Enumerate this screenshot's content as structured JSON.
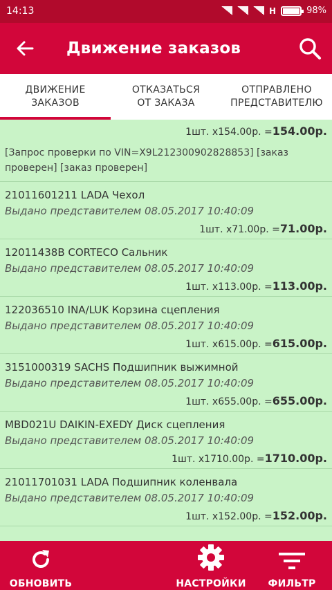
{
  "status_bar": {
    "time": "14:13",
    "network": "H",
    "battery": "98%"
  },
  "app_bar": {
    "title": "Движение заказов"
  },
  "tabs": [
    {
      "label": "ДВИЖЕНИЕ\nЗАКАЗОВ"
    },
    {
      "label": "ОТКАЗАТЬСЯ\nОТ ЗАКАЗА"
    },
    {
      "label": "ОТПРАВЛЕНО\nПРЕДСТАВИТЕЛЮ"
    }
  ],
  "first_item": {
    "price": "1шт. x154.00р. =",
    "total": "154.00р.",
    "note": "[Запрос проверки по VIN=X9L212300902828853] [заказ проверен] [заказ проверен]"
  },
  "items": [
    {
      "title": "21011601211 LADA Чехол",
      "status": "Выдано представителем 08.05.2017 10:40:09",
      "price": "1шт. x71.00р. =",
      "total": "71.00р."
    },
    {
      "title": "12011438B CORTECO Сальник",
      "status": "Выдано представителем 08.05.2017 10:40:09",
      "price": "1шт. x113.00р. =",
      "total": "113.00р."
    },
    {
      "title": "122036510 INA/LUK Корзина сцепления",
      "status": "Выдано представителем 08.05.2017 10:40:09",
      "price": "1шт. x615.00р. =",
      "total": "615.00р."
    },
    {
      "title": "3151000319 SACHS Подшипник выжимной",
      "status": "Выдано представителем 08.05.2017 10:40:09",
      "price": "1шт. x655.00р. =",
      "total": "655.00р."
    },
    {
      "title": "MBD021U DAIKIN-EXEDY Диск сцепления",
      "status": "Выдано представителем 08.05.2017 10:40:09",
      "price": "1шт. x1710.00р. =",
      "total": "1710.00р."
    },
    {
      "title": "21011701031 LADA Подшипник коленвала",
      "status": "Выдано представителем 08.05.2017 10:40:09",
      "price": "1шт. x152.00р. =",
      "total": "152.00р."
    }
  ],
  "bottom_bar": {
    "refresh_label": "ОБНОВИТЬ",
    "settings_label": "НАСТРОЙКИ",
    "filter_label": "ФИЛЬТР"
  },
  "colors": {
    "primary": "#d2063a",
    "status_bar": "#b10a2c",
    "list_bg": "#c9f3c7",
    "divider": "#a9d8a8"
  }
}
